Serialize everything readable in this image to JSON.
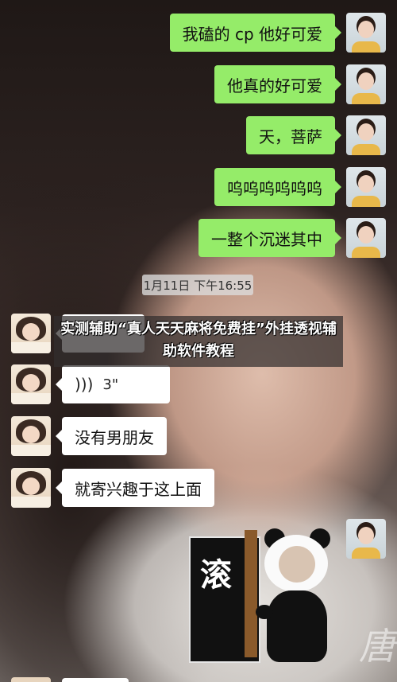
{
  "messages": [
    {
      "side": "me",
      "text": "我磕的 cp 他好可爱"
    },
    {
      "side": "me",
      "text": "他真的好可爱"
    },
    {
      "side": "me",
      "text": "天，菩萨"
    },
    {
      "side": "me",
      "text": "呜呜呜呜呜呜"
    },
    {
      "side": "me",
      "text": "一整个沉迷其中"
    },
    {
      "side": "them",
      "text": "没有男朋友"
    },
    {
      "side": "them",
      "text": "就寄兴趣于这上面"
    }
  ],
  "timestamp": "1月11日 下午16:55",
  "voice_message": {
    "duration": "3\""
  },
  "overlay_title": "实测辅助“真人天天麻将免费挂”外挂透视辅助软件教程",
  "sticker": {
    "text": "滚"
  },
  "watermark": "唐",
  "colors": {
    "me_bubble": "#95ec69",
    "them_bubble": "#ffffff"
  },
  "icons": {
    "voice": "voice-wave-icon"
  }
}
